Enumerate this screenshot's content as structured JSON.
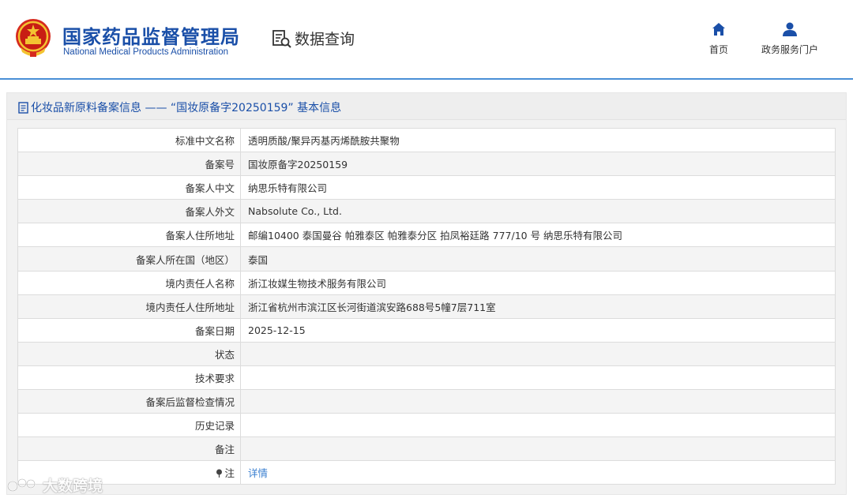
{
  "header": {
    "org_name_cn": "国家药品监督管理局",
    "org_name_en": "National Medical Products Administration",
    "query_label": "数据查询",
    "nav": [
      {
        "label": "首页",
        "icon": "home-icon"
      },
      {
        "label": "政务服务门户",
        "icon": "user-icon"
      }
    ]
  },
  "panel": {
    "title": "化妆品新原料备案信息 —— “国妆原备字20250159” 基本信息",
    "rows": [
      {
        "label": "标准中文名称",
        "value": "透明质酸/聚异丙基丙烯酰胺共聚物"
      },
      {
        "label": "备案号",
        "value": "国妆原备字20250159"
      },
      {
        "label": "备案人中文",
        "value": "纳思乐特有限公司"
      },
      {
        "label": "备案人外文",
        "value": "Nabsolute Co., Ltd."
      },
      {
        "label": "备案人住所地址",
        "value": "邮编10400 泰国曼谷 帕雅泰区 帕雅泰分区 拍凤裕廷路 777/10 号 纳思乐特有限公司"
      },
      {
        "label": "备案人所在国（地区）",
        "value": "泰国"
      },
      {
        "label": "境内责任人名称",
        "value": "浙江妆媒生物技术服务有限公司"
      },
      {
        "label": "境内责任人住所地址",
        "value": "浙江省杭州市滨江区长河街道滨安路688号5幢7层711室"
      },
      {
        "label": "备案日期",
        "value": "2025-12-15"
      },
      {
        "label": "状态",
        "value": ""
      },
      {
        "label": "技术要求",
        "value": ""
      },
      {
        "label": "备案后监督检查情况",
        "value": ""
      },
      {
        "label": "历史记录",
        "value": ""
      },
      {
        "label": "备注",
        "value": ""
      }
    ],
    "note_row": {
      "label": "注",
      "link": "详情"
    }
  },
  "watermark": {
    "text": "大数跨境"
  },
  "colors": {
    "brand_blue": "#1a4fa8",
    "link_blue": "#3a7fd0",
    "header_line": "#4a8fd6"
  }
}
